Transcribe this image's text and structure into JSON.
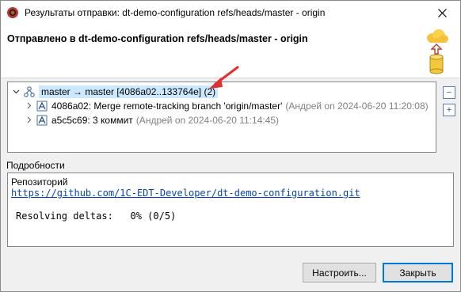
{
  "window": {
    "title": "Результаты отправки: dt-demo-configuration refs/heads/master - origin"
  },
  "header": {
    "title": "Отправлено в dt-demo-configuration refs/heads/master - origin",
    "icon": "cloud-upload-repository-icon"
  },
  "tree": {
    "root": {
      "label": "master → master [4086a02..133764e] (2)",
      "icon": "branch-icon"
    },
    "commits": [
      {
        "label": "4086a02: Merge remote-tracking branch 'origin/master'",
        "meta": "(Андрей on 2024-06-20 11:20:08)",
        "icon": "commit-icon"
      },
      {
        "label": "a5c5c69: 3 коммит",
        "meta": "(Андрей on 2024-06-20 11:14:45)",
        "icon": "commit-icon"
      }
    ],
    "collapse_all_symbol": "−",
    "expand_all_symbol": "+"
  },
  "details": {
    "group_label": "Подробности",
    "repo_label": "Репозиторий",
    "repo_url": "https://github.com/1C-EDT-Developer/dt-demo-configuration.git",
    "progress": "Resolving deltas:   0% (0/5)"
  },
  "buttons": {
    "configure": "Настроить...",
    "close": "Закрыть"
  },
  "colors": {
    "selection": "#cce8ff",
    "link": "#0645ad",
    "annotation_arrow": "#e03030"
  }
}
